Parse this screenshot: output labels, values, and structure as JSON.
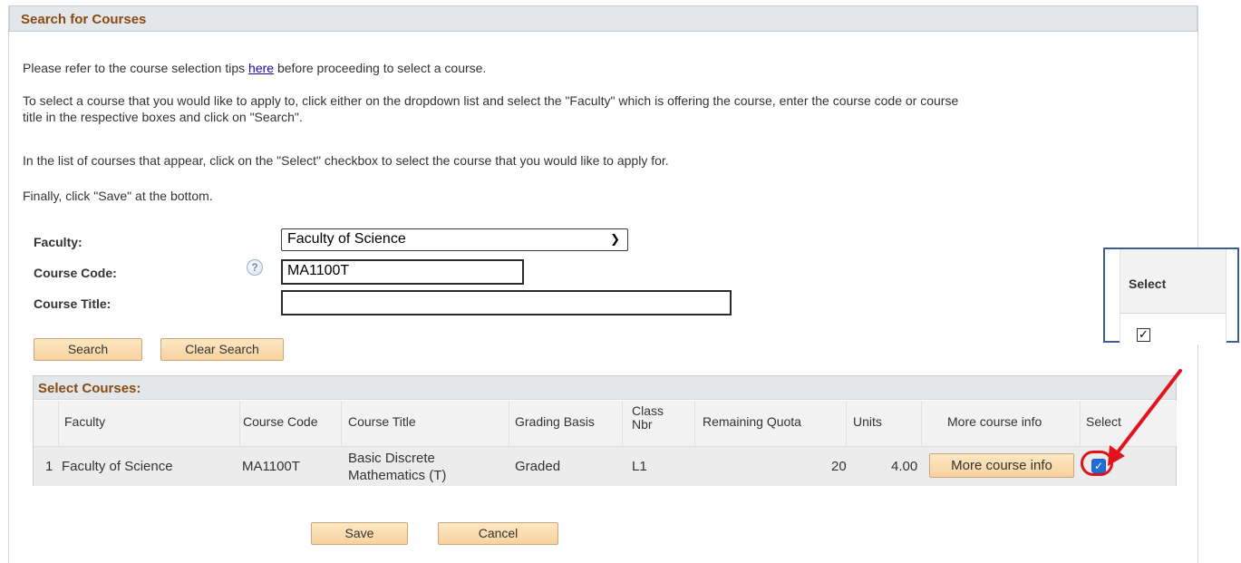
{
  "page": {
    "title": "Search for Courses",
    "intro_prefix": "Please refer to the course selection tips ",
    "intro_link": "here",
    "intro_suffix": " before proceeding to select a course.",
    "instruction_line1": "To select a course that you would like to apply to, click either on the dropdown list and select the \"Faculty\" which is offering the course, enter the course code or course",
    "instruction_line2": "title in the respective boxes and click on \"Search\".",
    "instruction_select": "In the list of courses that appear, click on the \"Select\" checkbox to select the course that you would like to apply for.",
    "instruction_save": "Finally, click \"Save\" at the bottom."
  },
  "form": {
    "faculty_label": "Faculty:",
    "faculty_value": "Faculty of Science",
    "course_code_label": "Course Code:",
    "course_code_value": "MA1100T",
    "course_title_label": "Course Title:",
    "course_title_value": "",
    "help_icon_glyph": "?"
  },
  "buttons": {
    "search": "Search",
    "clear_search": "Clear Search",
    "save": "Save",
    "cancel": "Cancel"
  },
  "grid": {
    "title": "Select Courses:",
    "columns": [
      "Faculty",
      "Course Code",
      "Course Title",
      "Grading Basis",
      "Class Nbr",
      "Remaining Quota",
      "Units",
      "More course info",
      "Select"
    ],
    "rows": [
      {
        "index": "1",
        "faculty": "Faculty of Science",
        "course_code": "MA1100T",
        "course_title_line1": "Basic Discrete",
        "course_title_line2": "Mathematics (T)",
        "grading_basis": "Graded",
        "class_nbr": "L1",
        "remaining_quota": "20",
        "units": "4.00",
        "more_info_label": "More course info",
        "selected": true
      }
    ]
  },
  "callout": {
    "header": "Select",
    "checked": true
  },
  "colors": {
    "accent_title": "#8b4a12",
    "button_fill": "#f7d29e",
    "highlight_red": "#e0141e",
    "callout_border": "#3d5e8c",
    "checkbox_blue": "#1f6fd6"
  }
}
